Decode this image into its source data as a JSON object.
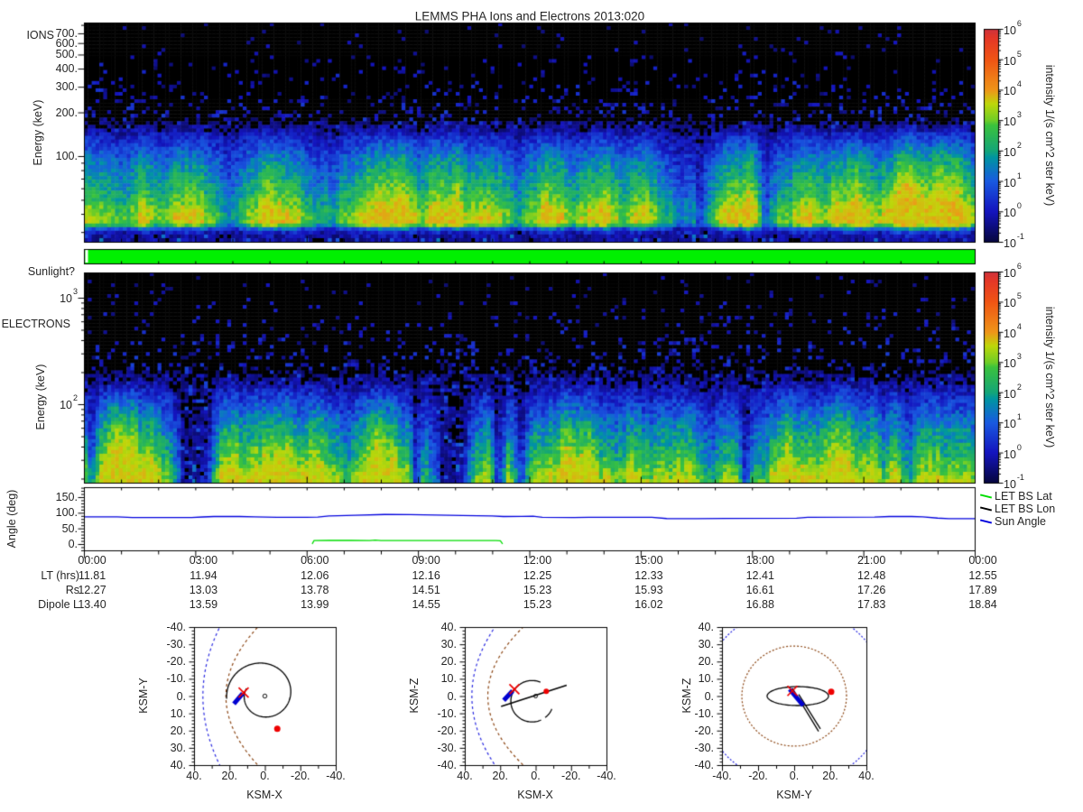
{
  "title": "LEMMS PHA Ions and Electrons  2013:020",
  "ions": {
    "panel_label": "IONS",
    "y_axis_label": "Energy (keV)",
    "y_ticks": [
      "700.",
      "600.",
      "500.",
      "400.",
      "300.",
      "200.",
      "100."
    ],
    "y_tick_keV": [
      700,
      600,
      500,
      400,
      300,
      200,
      100
    ]
  },
  "electrons": {
    "panel_label": "ELECTRONS",
    "y_axis_label": "Energy (keV)",
    "y_tick_exponents": [
      3,
      2
    ]
  },
  "colorbar": {
    "axis_label": "intensity 1/(s cm^2 ster keV)",
    "tick_exponents": [
      6,
      5,
      4,
      3,
      2,
      1,
      0,
      -1
    ],
    "gradient_stops": [
      [
        0,
        "#06063c"
      ],
      [
        0.143,
        "#1414be"
      ],
      [
        0.286,
        "#195ae1"
      ],
      [
        0.4,
        "#0096a0"
      ],
      [
        0.429,
        "#14a578"
      ],
      [
        0.55,
        "#3cc33c"
      ],
      [
        0.571,
        "#6ecd28"
      ],
      [
        0.65,
        "#bed70a"
      ],
      [
        0.714,
        "#ee9619"
      ],
      [
        0.857,
        "#f05514"
      ],
      [
        0.96,
        "#e43728"
      ],
      [
        1,
        "#cd323c"
      ]
    ]
  },
  "sunlight": {
    "label": "Sunlight?",
    "bar_color": "#00f000"
  },
  "angle": {
    "y_axis_label": "Angle (deg)",
    "y_ticks": [
      "150.",
      "100.",
      "50.",
      "0."
    ],
    "y_tick_deg": [
      150,
      100,
      50,
      0
    ],
    "legend": [
      {
        "label": "LET BS Lat",
        "color": "#00dd00"
      },
      {
        "label": "LET BS Lon",
        "color": "#000000"
      },
      {
        "label": "Sun Angle",
        "color": "#0000dd"
      }
    ]
  },
  "time_axis": {
    "tick_labels": [
      "00:00",
      "03:00",
      "06:00",
      "09:00",
      "12:00",
      "15:00",
      "18:00",
      "21:00",
      "00:00"
    ],
    "rows": [
      {
        "label": "LT (hrs)",
        "values": [
          "11.81",
          "11.94",
          "12.06",
          "12.16",
          "12.25",
          "12.33",
          "12.41",
          "12.48",
          "12.55"
        ]
      },
      {
        "label": "Rs",
        "values": [
          "12.27",
          "13.03",
          "13.78",
          "14.51",
          "15.23",
          "15.93",
          "16.61",
          "17.26",
          "17.89"
        ]
      },
      {
        "label": "Dipole L",
        "values": [
          "13.40",
          "13.59",
          "13.99",
          "14.55",
          "15.23",
          "16.02",
          "16.88",
          "17.83",
          "18.84"
        ]
      }
    ]
  },
  "orbits": [
    {
      "x_label": "KSM-X",
      "y_label": "KSM-Y",
      "x_tick_labels": [
        "40.",
        "20.",
        "0.",
        "-20.",
        "-40."
      ],
      "x_tick_vals": [
        40,
        20,
        0,
        -20,
        -40
      ],
      "y_tick_labels": [
        "-40.",
        "-30.",
        "-20.",
        "-10.",
        "0.",
        "10.",
        "20.",
        "30.",
        "40."
      ],
      "y_tick_vals": [
        -40,
        -30,
        -20,
        -10,
        0,
        10,
        20,
        30,
        40
      ]
    },
    {
      "x_label": "KSM-X",
      "y_label": "KSM-Z",
      "x_tick_labels": [
        "40.",
        "20.",
        "0.",
        "-20.",
        "-40."
      ],
      "x_tick_vals": [
        40,
        20,
        0,
        -20,
        -40
      ],
      "y_tick_labels": [
        "40.",
        "30.",
        "20.",
        "10.",
        "0.",
        "-10.",
        "-20.",
        "-30.",
        "-40."
      ],
      "y_tick_vals": [
        40,
        30,
        20,
        10,
        0,
        -10,
        -20,
        -30,
        -40
      ]
    },
    {
      "x_label": "KSM-Y",
      "y_label": "KSM-Z",
      "x_tick_labels": [
        "-40.",
        "-20.",
        "0.",
        "20.",
        "40."
      ],
      "x_tick_vals": [
        -40,
        -20,
        0,
        20,
        40
      ],
      "y_tick_labels": [
        "40.",
        "30.",
        "20.",
        "10.",
        "0.",
        "-10.",
        "-20.",
        "-30.",
        "-40."
      ],
      "y_tick_vals": [
        40,
        30,
        20,
        10,
        0,
        -10,
        -20,
        -30,
        -40
      ]
    }
  ],
  "heatmap_models": {
    "ion": {
      "rows": 60,
      "cols": 230,
      "seed": 1337,
      "noise": 0.14,
      "cap": 0.68,
      "sp0": 0.02,
      "sp1": 1.0,
      "base": [
        [
          0,
          -0.5
        ],
        [
          0.3,
          -0.28
        ],
        [
          0.42,
          -0.05
        ],
        [
          0.52,
          0.16
        ],
        [
          0.62,
          0.3
        ],
        [
          0.8,
          0.47
        ],
        [
          0.86,
          0.56
        ],
        [
          0.9,
          0.6
        ],
        [
          0.925,
          0.58
        ],
        [
          0.95,
          0.25
        ],
        [
          0.97,
          0.12
        ],
        [
          1,
          0.08
        ]
      ],
      "plumes": [
        [
          1.1,
          0.4,
          0.18
        ],
        [
          2.4,
          0.5,
          0.22
        ],
        [
          3.4,
          0.3,
          0.15
        ],
        [
          5.0,
          0.6,
          0.25
        ],
        [
          5.9,
          0.3,
          0.18
        ],
        [
          7.9,
          0.4,
          0.2
        ],
        [
          9.3,
          0.3,
          0.15
        ],
        [
          10.5,
          0.4,
          0.22
        ],
        [
          11.7,
          0.3,
          0.15
        ],
        [
          12.5,
          0.5,
          0.22
        ],
        [
          13.3,
          0.3,
          0.18
        ],
        [
          14.3,
          0.5,
          0.3
        ],
        [
          15.1,
          0.2,
          0.12
        ],
        [
          17.2,
          0.3,
          0.15
        ],
        [
          19.8,
          0.5,
          0.2
        ],
        [
          21.0,
          0.3,
          0.15
        ],
        [
          21.9,
          0.4,
          0.2
        ],
        [
          23.2,
          0.3,
          0.15
        ]
      ],
      "dropouts": [
        [
          16.6,
          0.15,
          0.5
        ],
        [
          18.3,
          0.1,
          0.4
        ]
      ]
    },
    "electron": {
      "rows": 58,
      "cols": 230,
      "seed": 777,
      "noise": 0.16,
      "cap": 0.66,
      "sp0": 0.03,
      "sp1": 0.9,
      "base": [
        [
          0,
          -0.45
        ],
        [
          0.25,
          -0.3
        ],
        [
          0.4,
          -0.1
        ],
        [
          0.52,
          0.08
        ],
        [
          0.62,
          0.22
        ],
        [
          0.72,
          0.34
        ],
        [
          0.82,
          0.44
        ],
        [
          0.9,
          0.52
        ],
        [
          0.96,
          0.62
        ],
        [
          1,
          0.68
        ]
      ],
      "plumes": [
        [
          0.6,
          0.3,
          0.15
        ],
        [
          3.9,
          0.6,
          0.2
        ],
        [
          6.3,
          0.4,
          0.15
        ],
        [
          8.3,
          1.2,
          0.12
        ],
        [
          12.4,
          0.3,
          0.25
        ],
        [
          13.0,
          0.2,
          0.3
        ],
        [
          13.6,
          0.2,
          0.25
        ],
        [
          14.5,
          0.4,
          0.2
        ],
        [
          16.4,
          0.3,
          0.15
        ],
        [
          19.6,
          0.4,
          0.2
        ],
        [
          20.4,
          0.3,
          0.18
        ],
        [
          22.6,
          0.3,
          0.15
        ]
      ],
      "dropouts": [
        [
          0.15,
          0.1,
          0.5
        ],
        [
          2.6,
          0.25,
          0.75
        ],
        [
          3.1,
          0.3,
          0.8
        ],
        [
          8.9,
          0.1,
          0.5
        ],
        [
          9.8,
          0.5,
          0.85
        ],
        [
          11.1,
          0.15,
          0.7
        ],
        [
          11.75,
          0.15,
          0.75
        ],
        [
          17.8,
          0.1,
          0.4
        ],
        [
          21.5,
          0.1,
          0.4
        ]
      ]
    }
  },
  "chart_data": [
    {
      "type": "heatmap",
      "title": "IONS",
      "ylabel": "Energy (keV)",
      "y_scale": "log",
      "y_range_keV": [
        26,
        830
      ],
      "x_range_hours": [
        0,
        24
      ],
      "colorbar_label": "intensity 1/(s cm^2 ster keV)",
      "colorbar_range": [
        0.1,
        1000000
      ],
      "summary": "Ion energy-time spectrogram: black with sparse blue speckle above ~200 keV, blue 100-200 keV, green-yellow band below ~60 keV with bright vertical plumes near hours 2.4, 5, 10.5, 12.5, 14.3, 19.8, 21.9; noisy dark strip along the lowest energies."
    },
    {
      "type": "heatmap",
      "title": "ELECTRONS",
      "ylabel": "Energy (keV)",
      "y_scale": "log",
      "y_range_keV": [
        19,
        1870
      ],
      "x_range_hours": [
        0,
        24
      ],
      "colorbar_label": "intensity 1/(s cm^2 ster keV)",
      "colorbar_range": [
        0.1,
        1000000
      ],
      "summary": "Electron energy-time spectrogram: black with blue speckle above ~300 keV, broad blue band 50-200 keV, green-yellow below ~40 keV; dark dropout streaks near hours 2.6, 3.1, 9.8, 11.1, 11.8 and bright low-energy streaks near hours 12.4-14.5 and 19.6-20.4."
    },
    {
      "type": "line",
      "title": "Angle (deg)",
      "ylim": [
        -20,
        181
      ],
      "x_range_hours": [
        0,
        24
      ],
      "legend_position": "right",
      "series": [
        {
          "name": "LET BS Lat",
          "color": "#00dd00",
          "points": [
            [
              6.15,
              0.5
            ],
            [
              6.2,
              11
            ],
            [
              6.6,
              11.5
            ],
            [
              7.2,
              11.5
            ],
            [
              7.7,
              11
            ],
            [
              7.85,
              12.5
            ],
            [
              8.0,
              11
            ],
            [
              8.9,
              11
            ],
            [
              10.5,
              11
            ],
            [
              11.1,
              11
            ],
            [
              11.22,
              10.5
            ],
            [
              11.28,
              0.5
            ]
          ]
        },
        {
          "name": "LET BS Lon",
          "color": "#000000",
          "points": []
        },
        {
          "name": "Sun Angle",
          "color": "#0000dd",
          "points": [
            [
              0,
              87
            ],
            [
              0.9,
              87
            ],
            [
              1.3,
              84.5
            ],
            [
              2.9,
              84.5
            ],
            [
              3.2,
              86.5
            ],
            [
              3.5,
              88
            ],
            [
              4.2,
              88
            ],
            [
              4.6,
              87
            ],
            [
              5.2,
              85.5
            ],
            [
              6.0,
              85.5
            ],
            [
              6.3,
              86
            ],
            [
              6.6,
              89.5
            ],
            [
              7.3,
              92
            ],
            [
              8.1,
              94.5
            ],
            [
              8.8,
              94
            ],
            [
              9.5,
              92.5
            ],
            [
              10.2,
              91
            ],
            [
              11.0,
              90
            ],
            [
              11.3,
              88
            ],
            [
              11.8,
              88.5
            ],
            [
              12.1,
              89
            ],
            [
              12.35,
              85.5
            ],
            [
              13.2,
              85
            ],
            [
              13.6,
              85.5
            ],
            [
              15.3,
              85.5
            ],
            [
              15.7,
              81.5
            ],
            [
              16.5,
              81
            ],
            [
              17.3,
              82
            ],
            [
              19.2,
              82.5
            ],
            [
              19.5,
              85.5
            ],
            [
              21.3,
              86
            ],
            [
              21.7,
              88
            ],
            [
              22.3,
              88
            ],
            [
              22.6,
              87
            ],
            [
              23.0,
              83
            ],
            [
              23.3,
              81
            ],
            [
              24,
              81
            ]
          ]
        }
      ]
    },
    {
      "type": "table",
      "columns": [
        "00:00",
        "03:00",
        "06:00",
        "09:00",
        "12:00",
        "15:00",
        "18:00",
        "21:00",
        "00:00"
      ],
      "rows": [
        {
          "label": "LT (hrs)",
          "values": [
            11.81,
            11.94,
            12.06,
            12.16,
            12.25,
            12.33,
            12.41,
            12.48,
            12.55
          ]
        },
        {
          "label": "Rs",
          "values": [
            12.27,
            13.03,
            13.78,
            14.51,
            15.23,
            15.93,
            16.61,
            17.26,
            17.89
          ]
        },
        {
          "label": "Dipole L",
          "values": [
            13.4,
            13.59,
            13.99,
            14.55,
            15.23,
            16.02,
            16.88,
            17.83,
            18.84
          ]
        }
      ]
    },
    {
      "type": "scatter",
      "title": "Trajectory KSM-Y vs KSM-X",
      "xlabel": "KSM-X",
      "ylabel": "KSM-Y",
      "xlim": [
        40,
        -40
      ],
      "ylim": [
        -40,
        40
      ],
      "features": [
        {
          "kind": "parabola",
          "color": "#2929e0",
          "dash": [
            3,
            3
          ],
          "vx": 35,
          "k": 9.5
        },
        {
          "kind": "parabola",
          "color": "#8B4513",
          "dash": [
            3,
            3
          ],
          "vx": 22,
          "k": 18
        },
        {
          "kind": "spiral",
          "color": "#000000",
          "cx": 1,
          "cy": -1,
          "r0": 10,
          "r1": 20.8,
          "a0": -0.35,
          "turns": 1.08
        },
        {
          "kind": "dot_open",
          "color": "#000000",
          "x": 0,
          "y": 0,
          "rpx": 2.2
        },
        {
          "kind": "thickline",
          "color": "#0000d0",
          "x1": 17.5,
          "y1": 4.5,
          "x2": 12.5,
          "y2": -1.5,
          "w": 5
        },
        {
          "kind": "xmark",
          "color": "#ee0000",
          "x": 12,
          "y": -2
        },
        {
          "kind": "dot",
          "color": "#ee0000",
          "x": -7,
          "y": 19,
          "rpx": 3.5
        }
      ]
    },
    {
      "type": "scatter",
      "title": "Trajectory KSM-Z vs KSM-X",
      "xlabel": "KSM-X",
      "ylabel": "KSM-Z",
      "xlim": [
        40,
        -40
      ],
      "ylim": [
        -40,
        40
      ],
      "features": [
        {
          "kind": "parabola",
          "color": "#2929e0",
          "dash": [
            3,
            3
          ],
          "vx": 36,
          "k": 13
        },
        {
          "kind": "parabola",
          "color": "#8B4513",
          "dash": [
            3,
            3
          ],
          "vx": 27,
          "k": 20
        },
        {
          "kind": "arc",
          "color": "#000000",
          "cx": 2,
          "cy": -3,
          "r": 12,
          "a1": -115,
          "a2": 115
        },
        {
          "kind": "arc",
          "color": "#000000",
          "cx": 2,
          "cy": -3,
          "r": 12,
          "a1": -158,
          "a2": -128
        },
        {
          "kind": "line",
          "color": "#000000",
          "x1": 19.5,
          "y1": -6,
          "x2": -17.5,
          "y2": 6.3,
          "w": 1.5
        },
        {
          "kind": "dot_open",
          "color": "#000000",
          "x": 0,
          "y": 0,
          "rpx": 2
        },
        {
          "kind": "thickline",
          "color": "#0000d0",
          "x1": 18,
          "y1": -2.5,
          "x2": 13,
          "y2": 3,
          "w": 5
        },
        {
          "kind": "xmark",
          "color": "#ee0000",
          "x": 12,
          "y": 4
        },
        {
          "kind": "dot",
          "color": "#ee0000",
          "x": -6,
          "y": 2.7,
          "rpx": 3
        }
      ]
    },
    {
      "type": "scatter",
      "title": "Trajectory KSM-Z vs KSM-Y",
      "xlabel": "KSM-Y",
      "ylabel": "KSM-Z",
      "xlim": [
        -40,
        40
      ],
      "ylim": [
        -40,
        40
      ],
      "features": [
        {
          "kind": "circle",
          "color": "#8B4513",
          "dash": [
            2,
            2
          ],
          "cx": 0,
          "cy": 0,
          "r": 29
        },
        {
          "kind": "circle",
          "color": "#2929e0",
          "dash": [
            2,
            2
          ],
          "cx": 0,
          "cy": 0,
          "r": 51
        },
        {
          "kind": "ellipse",
          "color": "#000000",
          "cx": 2,
          "cy": 0,
          "rx": 17,
          "ry": 5.5
        },
        {
          "kind": "line",
          "color": "#000000",
          "x1": -1,
          "y1": 4.5,
          "x2": 13.5,
          "y2": -20.5,
          "w": 1.3
        },
        {
          "kind": "line",
          "color": "#000000",
          "x1": 2.5,
          "y1": 1,
          "x2": 14.5,
          "y2": -19,
          "w": 1.3
        },
        {
          "kind": "thickline",
          "color": "#0000d0",
          "x1": -2.5,
          "y1": 4,
          "x2": 5,
          "y2": -5.5,
          "w": 5
        },
        {
          "kind": "xmark",
          "color": "#ee0000",
          "x": -1,
          "y": 3
        },
        {
          "kind": "dot",
          "color": "#ee0000",
          "x": 20.5,
          "y": 2.5,
          "rpx": 3.5
        }
      ]
    }
  ]
}
